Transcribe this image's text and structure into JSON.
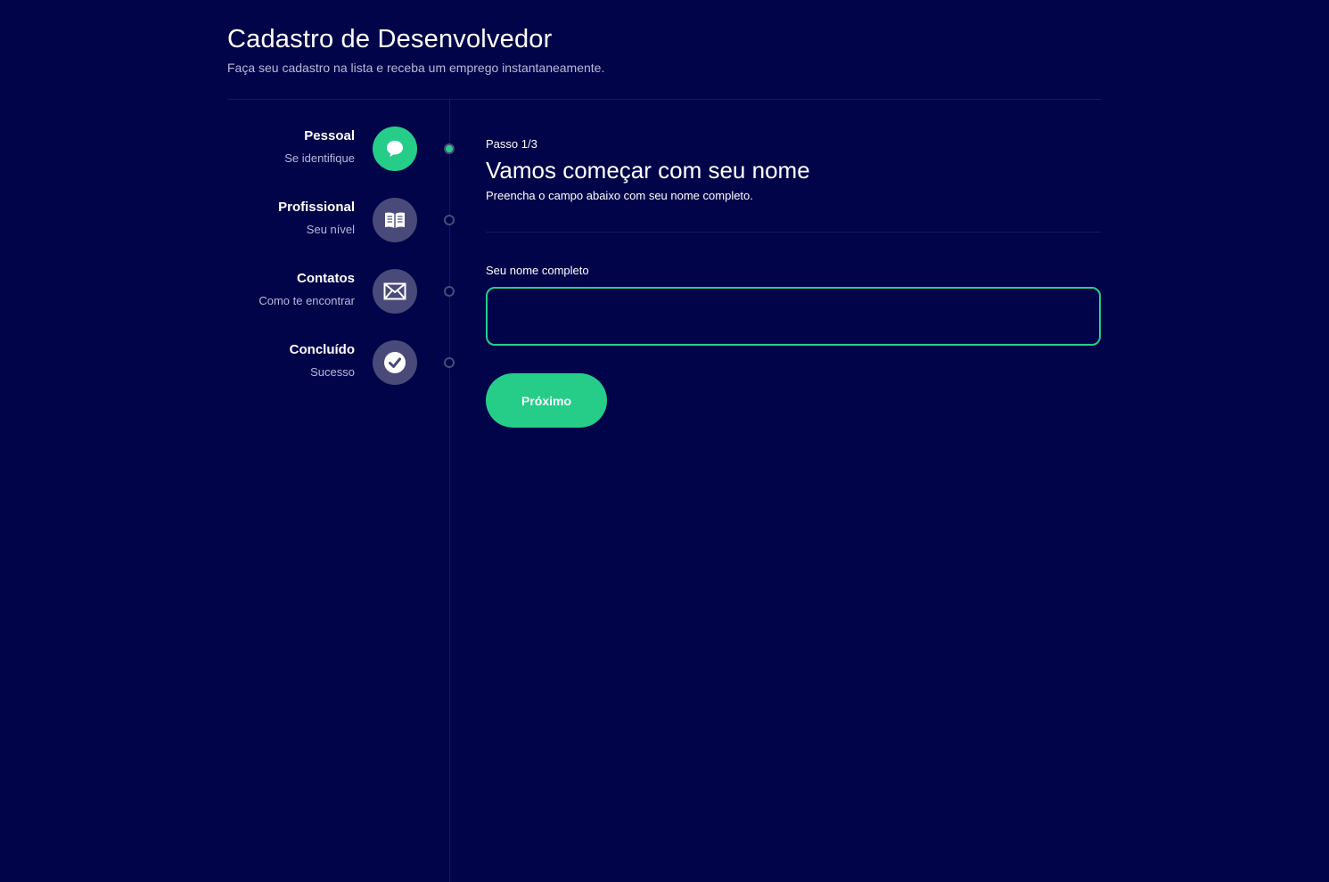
{
  "header": {
    "title": "Cadastro de Desenvolvedor",
    "subtitle": "Faça seu cadastro na lista e receba um emprego instantaneamente."
  },
  "steps": [
    {
      "title": "Pessoal",
      "description": "Se identifique",
      "icon": "chat-bubble-icon",
      "active": true
    },
    {
      "title": "Profissional",
      "description": "Seu nível",
      "icon": "book-icon",
      "active": false
    },
    {
      "title": "Contatos",
      "description": "Como te encontrar",
      "icon": "envelope-icon",
      "active": false
    },
    {
      "title": "Concluído",
      "description": "Sucesso",
      "icon": "check-circle-icon",
      "active": false
    }
  ],
  "main": {
    "step_counter": "Passo 1/3",
    "title": "Vamos começar com seu nome",
    "description": "Preencha o campo abaixo com seu nome completo.",
    "field_label": "Seu nome completo",
    "field_value": "",
    "next_label": "Próximo"
  },
  "colors": {
    "background": "#02044a",
    "accent": "#25cd89",
    "inactive": "#494a79",
    "muted_text": "#b8b9d9"
  }
}
